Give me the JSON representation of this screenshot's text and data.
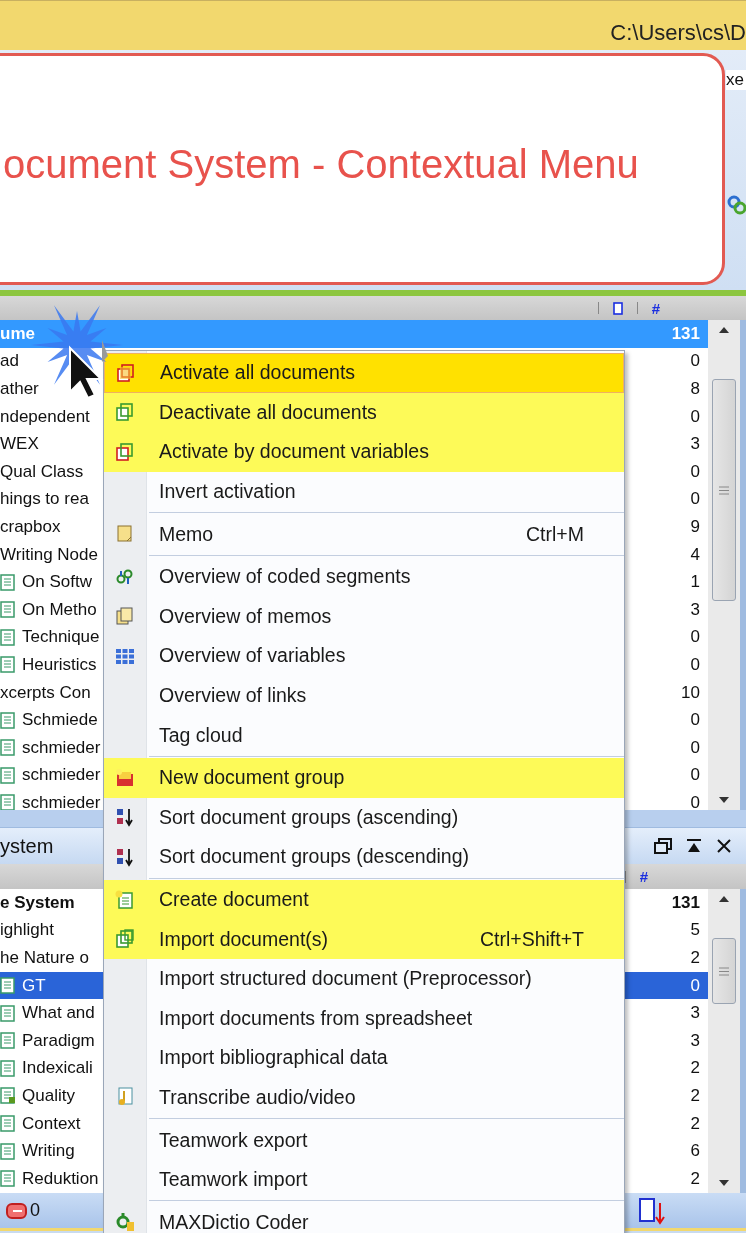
{
  "title_bar": {
    "path": "C:\\Users\\cs\\D"
  },
  "toolbar": {
    "partial_label": "xe"
  },
  "callout": {
    "title": "ocument System - Contextual Menu"
  },
  "top_panel": {
    "count_header": "#",
    "rows": [
      {
        "label": "ume",
        "count": "131",
        "selected": true,
        "children": [
          {
            "label": "ad",
            "count": "0",
            "selected": false
          },
          {
            "label": "ather",
            "count": "8",
            "selected": false
          },
          {
            "label": "ndependent",
            "count": "0",
            "selected": false
          },
          {
            "label": "WEX",
            "count": "3",
            "selected": false
          },
          {
            "label": "Qual Class",
            "count": "0",
            "selected": false
          },
          {
            "label": "hings to rea",
            "count": "0",
            "selected": false
          },
          {
            "label": "crapbox",
            "count": "9",
            "selected": false
          },
          {
            "label": "Writing Node",
            "count": "4",
            "selected": false,
            "children": [
              {
                "label": "On Softw",
                "count": "1",
                "selected": false,
                "kind": "text"
              },
              {
                "label": "On Metho",
                "count": "3",
                "selected": false,
                "kind": "text"
              },
              {
                "label": "Technique",
                "count": "0",
                "selected": false,
                "kind": "text"
              },
              {
                "label": "Heuristics",
                "count": "0",
                "selected": false,
                "kind": "text"
              }
            ]
          },
          {
            "label": "xcerpts Con",
            "count": "10",
            "selected": false,
            "children": [
              {
                "label": "Schmiede",
                "count": "0",
                "selected": false,
                "kind": "text"
              },
              {
                "label": "schmieder",
                "count": "0",
                "selected": false,
                "kind": "text"
              },
              {
                "label": "schmieder",
                "count": "0",
                "selected": false,
                "kind": "text"
              },
              {
                "label": "schmieder",
                "count": "0",
                "selected": false,
                "kind": "text"
              }
            ]
          }
        ]
      }
    ]
  },
  "bottom_panel": {
    "title": "ystem",
    "count_header": "#",
    "rows": [
      {
        "label": "e System",
        "count": "131",
        "selected": false,
        "children": [
          {
            "label": "ighlight",
            "count": "5",
            "selected": false
          },
          {
            "label": "he Nature o",
            "count": "2",
            "selected": false,
            "children": [
              {
                "label": "GT",
                "count": "0",
                "selected": true,
                "kind": "text"
              },
              {
                "label": "What and",
                "count": "3",
                "selected": false,
                "kind": "text"
              },
              {
                "label": "Paradigm",
                "count": "3",
                "selected": false,
                "kind": "text"
              },
              {
                "label": "Indexicali",
                "count": "2",
                "selected": false,
                "kind": "text"
              },
              {
                "label": "Quality",
                "count": "2",
                "selected": false,
                "kind": "text-marked"
              },
              {
                "label": "Context",
                "count": "2",
                "selected": false,
                "kind": "text"
              },
              {
                "label": "Writing",
                "count": "6",
                "selected": false,
                "kind": "text"
              },
              {
                "label": "Reduktion",
                "count": "2",
                "selected": false,
                "kind": "text"
              }
            ]
          }
        ]
      }
    ]
  },
  "status_bar": {
    "count": "0"
  },
  "menu": {
    "items": [
      {
        "kind": "item",
        "label": "Activate all documents",
        "hovered": true,
        "highlighted": true
      },
      {
        "kind": "item",
        "label": "Deactivate all documents",
        "hovered": false,
        "highlighted": true
      },
      {
        "kind": "item",
        "label": "Activate by document variables",
        "hovered": false,
        "highlighted": true
      },
      {
        "kind": "item",
        "label": "Invert activation",
        "hovered": false,
        "highlighted": false
      },
      {
        "kind": "separator"
      },
      {
        "kind": "item",
        "label": "Memo",
        "shortcut": "Ctrl+M",
        "hovered": false,
        "highlighted": false
      },
      {
        "kind": "separator"
      },
      {
        "kind": "item",
        "label": "Overview of coded segments",
        "hovered": false,
        "highlighted": false
      },
      {
        "kind": "item",
        "label": "Overview of memos",
        "hovered": false,
        "highlighted": false
      },
      {
        "kind": "item",
        "label": "Overview of variables",
        "hovered": false,
        "highlighted": false
      },
      {
        "kind": "item",
        "label": "Overview of links",
        "hovered": false,
        "highlighted": false
      },
      {
        "kind": "item",
        "label": "Tag cloud",
        "hovered": false,
        "highlighted": false
      },
      {
        "kind": "separator"
      },
      {
        "kind": "item",
        "label": "New document group",
        "hovered": false,
        "highlighted": true
      },
      {
        "kind": "item",
        "label": "Sort document groups (ascending)",
        "hovered": false,
        "highlighted": false
      },
      {
        "kind": "item",
        "label": "Sort document groups (descending)",
        "hovered": false,
        "highlighted": false
      },
      {
        "kind": "separator"
      },
      {
        "kind": "item",
        "label": "Create document",
        "hovered": false,
        "highlighted": true
      },
      {
        "kind": "item",
        "label": "Import document(s)",
        "shortcut": "Ctrl+Shift+T",
        "hovered": false,
        "highlighted": true
      },
      {
        "kind": "item",
        "label": "Import structured document (Preprocessor)",
        "hovered": false,
        "highlighted": false
      },
      {
        "kind": "item",
        "label": "Import documents from spreadsheet",
        "hovered": false,
        "highlighted": false
      },
      {
        "kind": "item",
        "label": "Import bibliographical data",
        "hovered": false,
        "highlighted": false
      },
      {
        "kind": "item",
        "label": "Transcribe audio/video",
        "hovered": false,
        "highlighted": false
      },
      {
        "kind": "separator"
      },
      {
        "kind": "item",
        "label": "Teamwork export",
        "hovered": false,
        "highlighted": false
      },
      {
        "kind": "item",
        "label": "Teamwork import",
        "hovered": false,
        "highlighted": false
      },
      {
        "kind": "separator"
      },
      {
        "kind": "item",
        "label": "MAXDictio Coder",
        "hovered": false,
        "highlighted": false
      }
    ]
  }
}
